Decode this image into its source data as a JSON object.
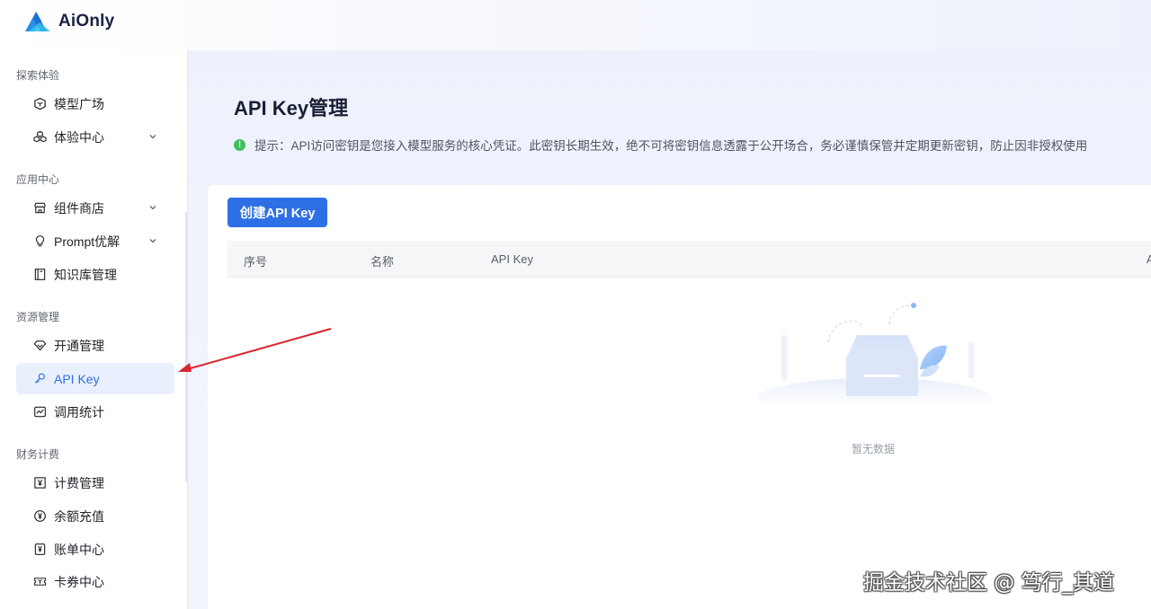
{
  "app": {
    "name": "AiOnly"
  },
  "sidebar": {
    "groups": [
      {
        "title": "探索体验",
        "items": [
          {
            "label": "模型广场",
            "icon": "cube-icon",
            "has_chevron": false
          },
          {
            "label": "体验中心",
            "icon": "cubes-icon",
            "has_chevron": true
          }
        ]
      },
      {
        "title": "应用中心",
        "items": [
          {
            "label": "组件商店",
            "icon": "store-icon",
            "has_chevron": true
          },
          {
            "label": "Prompt优解",
            "icon": "bulb-icon",
            "has_chevron": true
          },
          {
            "label": "知识库管理",
            "icon": "book-icon",
            "has_chevron": false
          }
        ]
      },
      {
        "title": "资源管理",
        "items": [
          {
            "label": "开通管理",
            "icon": "diamond-icon",
            "has_chevron": false
          },
          {
            "label": "API Key",
            "icon": "key-icon",
            "has_chevron": false,
            "active": true
          },
          {
            "label": "调用统计",
            "icon": "chart-icon",
            "has_chevron": false
          }
        ]
      },
      {
        "title": "财务计费",
        "items": [
          {
            "label": "计费管理",
            "icon": "yen-doc-icon",
            "has_chevron": false
          },
          {
            "label": "余额充值",
            "icon": "yen-circle-icon",
            "has_chevron": false
          },
          {
            "label": "账单中心",
            "icon": "bill-icon",
            "has_chevron": false
          },
          {
            "label": "卡券中心",
            "icon": "coupon-icon",
            "has_chevron": false
          }
        ]
      }
    ]
  },
  "main": {
    "title": "API Key管理",
    "tip": "提示：API访问密钥是您接入模型服务的核心凭证。此密钥长期生效，绝不可将密钥信息透露于公开场合，务必谨慎保管并定期更新密钥，防止因非授权使用",
    "create_button": "创建API Key",
    "table": {
      "columns": [
        "序号",
        "名称",
        "API Key",
        "A"
      ]
    },
    "empty_text": "暂无数据"
  },
  "watermark": "掘金技术社区 @ 笃行_其道",
  "colors": {
    "accent": "#2f6fe6",
    "active_bg": "#e9effc",
    "tip_icon": "#3ec05c",
    "arrow": "#d9262c"
  }
}
